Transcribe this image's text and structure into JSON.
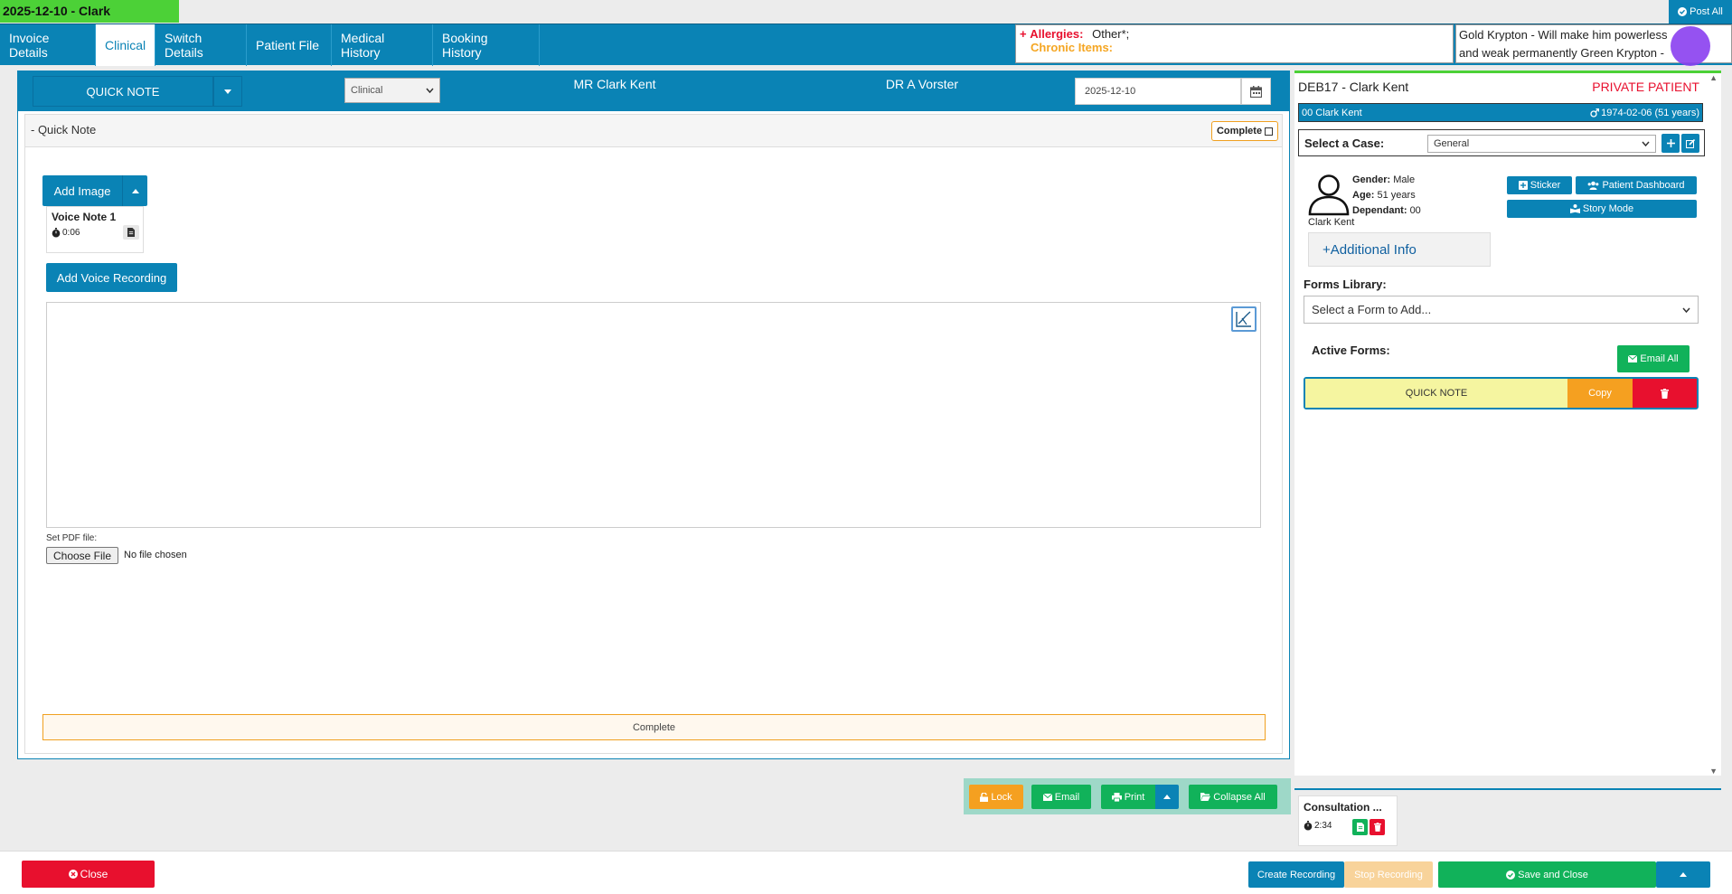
{
  "top": {
    "date_badge": "2025-12-10 - Clark",
    "post_all": "Post All",
    "tabs": [
      {
        "label": "Invoice Details"
      },
      {
        "label": "Clinical"
      },
      {
        "label": "Switch Details"
      },
      {
        "label": "Patient File"
      },
      {
        "label": "Medical History"
      },
      {
        "label": "Booking History"
      }
    ],
    "allergies_plus": "+",
    "allergies_label": "Allergies:",
    "allergies_value": "Other*;",
    "chronic_label": "Chronic Items:",
    "note_line1": "Gold Krypton - Will make him powerless",
    "note_line2": "and weak permanently Green Krypton -"
  },
  "main": {
    "quick_note_btn": "QUICK NOTE",
    "category_select": "Clinical",
    "patient_name": "MR Clark Kent",
    "doctor_name": "DR A Vorster",
    "date_value": "2025-12-10",
    "form_title": "- Quick Note",
    "complete_chk": "Complete",
    "add_image": "Add Image",
    "voice_note_title": "Voice Note 1",
    "voice_note_time": "0:06",
    "add_voice": "Add Voice Recording",
    "pdf_label": "Set PDF file:",
    "choose_file": "Choose File",
    "no_file": "No file chosen",
    "complete_bar": "Complete"
  },
  "actions": {
    "lock": "Lock",
    "email": "Email",
    "print": "Print",
    "collapse_all": "Collapse All"
  },
  "right": {
    "patient_id": "DEB17 - Clark Kent",
    "private_label": "PRIVATE PATIENT",
    "strip_name": "00 Clark Kent",
    "strip_dob": "1974-02-06 (51 years)",
    "case_label": "Select a Case:",
    "case_value": "General",
    "gender_label": "Gender:",
    "gender_value": "Male",
    "age_label": "Age:",
    "age_value": "51 years",
    "dependant_label": "Dependant:",
    "dependant_value": "00",
    "avatar_name": "Clark Kent",
    "additional_info": "+Additional Info",
    "sticker": "Sticker",
    "patient_dashboard": "Patient Dashboard",
    "story_mode": "Story Mode",
    "forms_library": "Forms Library:",
    "form_select_placeholder": "Select a Form to Add...",
    "active_forms": "Active Forms:",
    "email_all": "Email All",
    "active_form_name": "QUICK NOTE",
    "copy": "Copy",
    "consult_title": "Consultation ...",
    "consult_time": "2:34"
  },
  "footer": {
    "close": "Close",
    "create_recording": "Create Recording",
    "stop_recording": "Stop Recording",
    "save_and_close": "Save and Close"
  },
  "colors": {
    "primary_blue": "#0a83b5",
    "green": "#11b25a",
    "badge_green": "#4cd137",
    "orange": "#f5a020",
    "red": "#e8102e"
  }
}
